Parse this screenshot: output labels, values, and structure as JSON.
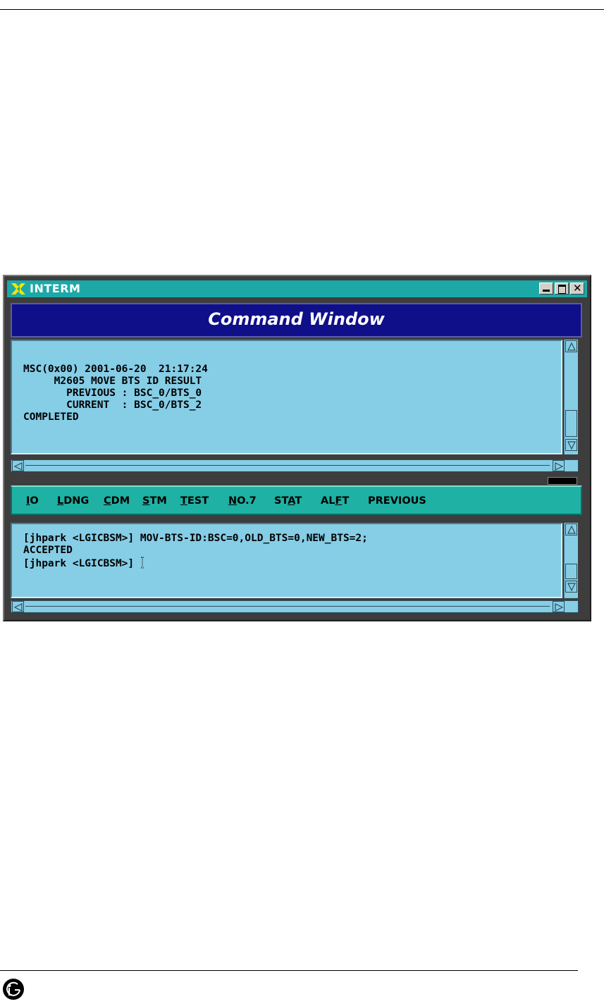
{
  "window": {
    "title": "INTERM",
    "banner": "Command Window"
  },
  "output": {
    "lines": [
      "MSC(0x00) 2001-06-20  21:17:24",
      "     M2605 MOVE BTS ID RESULT",
      "       PREVIOUS : BSC_0/BTS_0",
      "       CURRENT  : BSC_0/BTS_2",
      "COMPLETED"
    ]
  },
  "menu": {
    "items": [
      {
        "label": "IO",
        "mnemonic_index": 0
      },
      {
        "label": "LDNG",
        "mnemonic_index": 0
      },
      {
        "label": "CDM",
        "mnemonic_index": 0
      },
      {
        "label": "STM",
        "mnemonic_index": 0
      },
      {
        "label": "TEST",
        "mnemonic_index": 0
      },
      {
        "label": "NO.7",
        "mnemonic_index": 0
      },
      {
        "label": "STAT",
        "mnemonic_index": 2
      },
      {
        "label": "ALFT",
        "mnemonic_index": 2
      },
      {
        "label": "PREVIOUS",
        "mnemonic_index": -1
      }
    ]
  },
  "input": {
    "lines": [
      "[jhpark <LGICBSM>] MOV-BTS-ID:BSC=0,OLD_BTS=0,NEW_BTS=2;",
      "ACCEPTED",
      "[jhpark <LGICBSM>] "
    ]
  },
  "colors": {
    "titlebar": "#1da8a8",
    "banner": "#0f0f8a",
    "panel": "#86cde6",
    "menubar": "#1fb1a4"
  },
  "icons": {
    "app": "x-logo-icon",
    "minimize": "minimize-icon",
    "maximize": "maximize-icon",
    "close": "close-icon",
    "footer": "lg-logo-icon"
  }
}
